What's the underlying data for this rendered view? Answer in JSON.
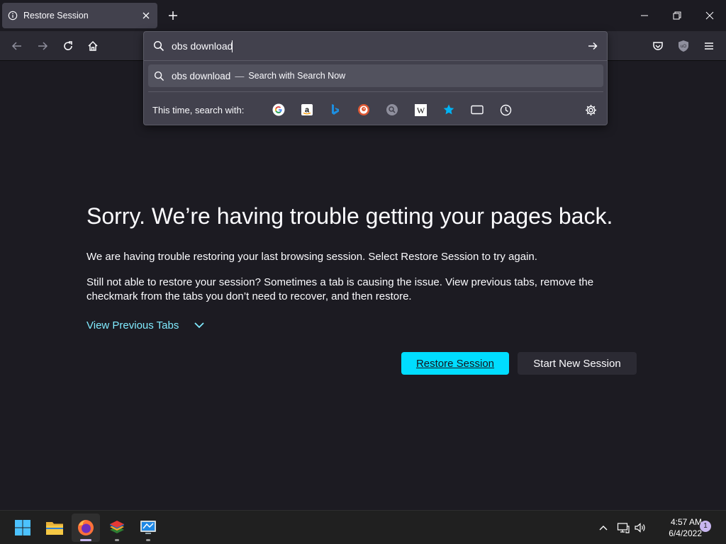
{
  "tab": {
    "title": "Restore Session"
  },
  "urlbar": {
    "value": "obs download",
    "result_query": "obs download",
    "result_dash": "—",
    "result_engine": "Search with Search Now",
    "oneoff_label": "This time, search with:",
    "oneoff_icons": [
      "google-icon",
      "amazon-icon",
      "bing-icon",
      "duckduckgo-icon",
      "search-engine-icon",
      "wikipedia-icon",
      "bookmarks-icon",
      "tabs-icon",
      "history-icon"
    ]
  },
  "main": {
    "title": "Sorry. We’re having trouble getting your pages back.",
    "para1": "We are having trouble restoring your last browsing session. Select Restore Session to try again.",
    "para2": "Still not able to restore your session? Sometimes a tab is causing the issue. View previous tabs, remove the checkmark from the tabs you don’t need to recover, and then restore.",
    "view_previous": "View Previous Tabs",
    "restore_button": "Restore Session",
    "new_session_button": "Start New Session"
  },
  "taskbar": {
    "time": "4:57 AM",
    "date": "6/4/2022",
    "notification_count": "1"
  },
  "colors": {
    "accent": "#00ddff",
    "link": "#80ebff",
    "page_bg": "#1c1b22",
    "toolbar_bg": "#2b2a33"
  }
}
